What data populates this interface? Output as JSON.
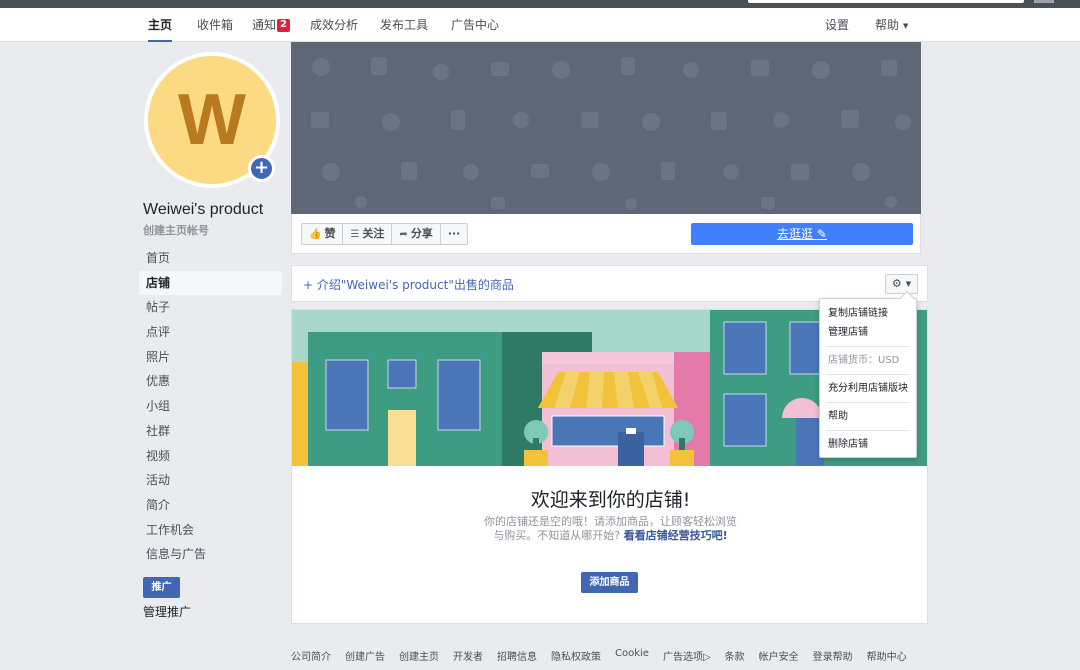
{
  "nav": {
    "items": [
      {
        "label": "主页",
        "active": true
      },
      {
        "label": "收件箱"
      },
      {
        "label": "通知",
        "badge": "2"
      },
      {
        "label": "成效分析"
      },
      {
        "label": "发布工具"
      },
      {
        "label": "广告中心"
      }
    ],
    "settings": "设置",
    "help": "帮助"
  },
  "profile": {
    "avatar_letter": "W",
    "name": "Weiwei's product",
    "handle": "创建主页帐号"
  },
  "sidebar": {
    "items": [
      {
        "label": "首页"
      },
      {
        "label": "店铺",
        "active": true
      },
      {
        "label": "帖子"
      },
      {
        "label": "点评"
      },
      {
        "label": "照片"
      },
      {
        "label": "优惠"
      },
      {
        "label": "小组"
      },
      {
        "label": "社群"
      },
      {
        "label": "视频"
      },
      {
        "label": "活动"
      },
      {
        "label": "简介"
      },
      {
        "label": "工作机会"
      },
      {
        "label": "信息与广告"
      }
    ],
    "promote_label": "推广",
    "manage_promotions": "管理推广"
  },
  "actions": {
    "like": "赞",
    "follow": "关注",
    "share": "分享",
    "more": "···",
    "shop_button": "去逛逛"
  },
  "intro": {
    "link_text": "+ 介绍\"Weiwei's product\"出售的商品"
  },
  "shop": {
    "title": "欢迎来到你的店铺!",
    "text_before": "你的店铺还是空的哦！请添加商品，让顾客轻松浏览与购买。不知道从哪开始?",
    "tips_link": "看看店铺经营技巧吧!",
    "add_product": "添加商品"
  },
  "dropdown": {
    "copy_link": "复制店铺链接",
    "manage_shop": "管理店铺",
    "currency": "店铺货币：USD",
    "make_most": "充分利用店铺版块",
    "help": "帮助",
    "delete_shop": "删除店铺"
  },
  "footer": {
    "links": [
      "公司简介",
      "创建广告",
      "创建主页",
      "开发者",
      "招聘信息",
      "隐私权政策",
      "Cookie",
      "广告选项▷",
      "条款",
      "帐户安全",
      "登录帮助",
      "帮助中心"
    ]
  },
  "colors": {
    "accent": "#4267b2",
    "shop_button": "#4080ff",
    "avatar_bg": "#fcd983",
    "avatar_letter": "#b8791f",
    "cover_bg": "#5f6675"
  }
}
